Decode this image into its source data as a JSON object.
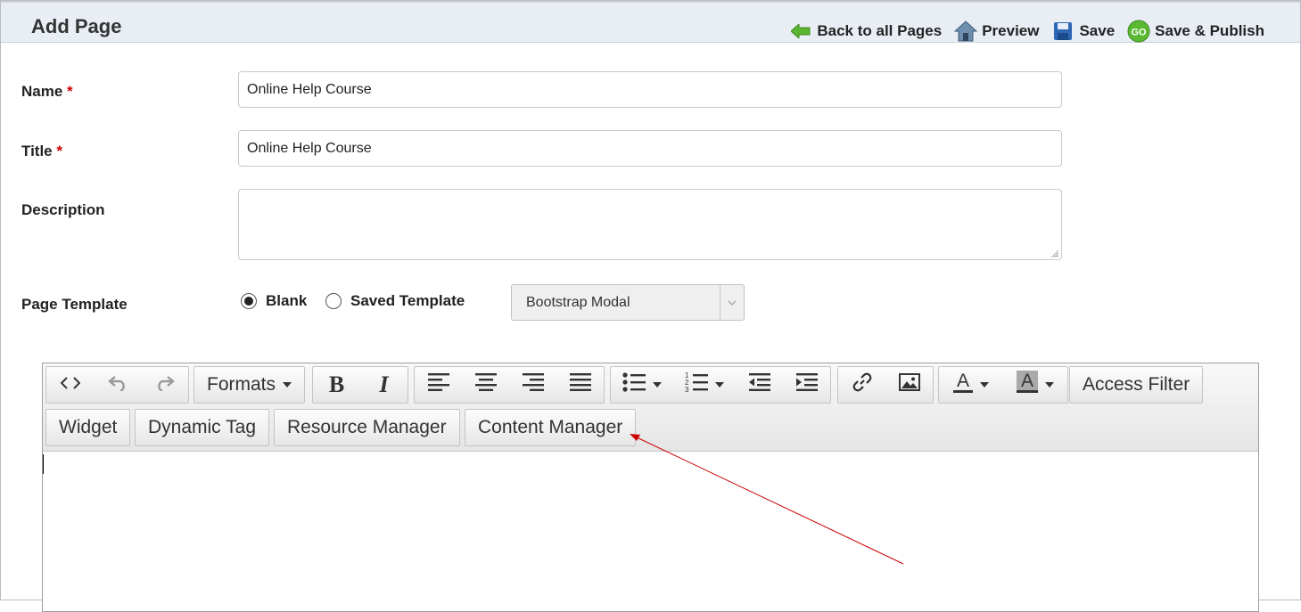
{
  "header": {
    "title": "Add Page",
    "actions": {
      "back": "Back to all Pages",
      "preview": "Preview",
      "save": "Save",
      "publish": "Save & Publish"
    }
  },
  "form": {
    "name_label": "Name",
    "name_value": "Online Help Course",
    "title_label": "Title",
    "title_value": "Online Help Course",
    "description_label": "Description",
    "description_value": "",
    "required_mark": "*",
    "template_label": "Page Template",
    "radio_blank": "Blank",
    "radio_saved": "Saved Template",
    "template_select_value": "Bootstrap Modal"
  },
  "toolbar": {
    "formats": "Formats",
    "access_filter": "Access Filter",
    "widget": "Widget",
    "dynamic_tag": "Dynamic Tag",
    "resource_manager": "Resource Manager",
    "content_manager": "Content Manager"
  },
  "colors": {
    "header_bg": "#e9eef5",
    "required": "#cc0000",
    "annotation_arrow": "#cc0000",
    "go_icon": "#5bb832"
  }
}
